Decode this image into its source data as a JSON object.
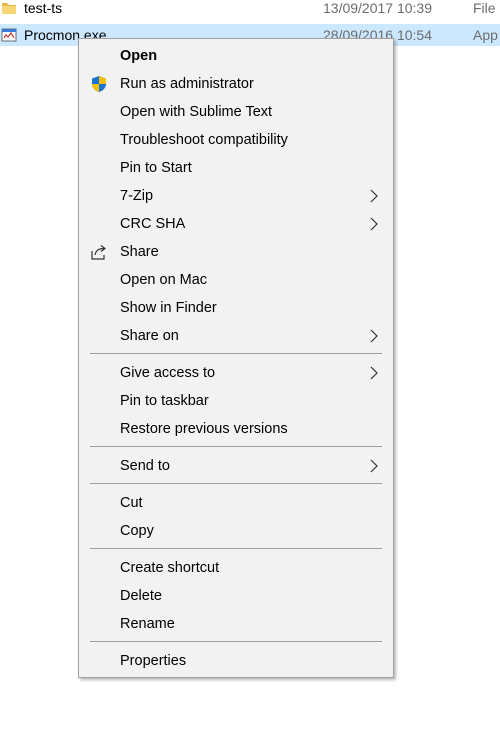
{
  "files": [
    {
      "name": "test-ts",
      "date": "13/09/2017 10:39",
      "type": "File",
      "icon": "folder-icon"
    },
    {
      "name": "Procmon.exe",
      "date": "28/09/2016 10:54",
      "type": "App",
      "icon": "application-icon"
    }
  ],
  "menu": {
    "open": "Open",
    "run_as_admin": "Run as administrator",
    "open_with_sublime": "Open with Sublime Text",
    "troubleshoot": "Troubleshoot compatibility",
    "pin_to_start": "Pin to Start",
    "seven_zip": "7-Zip",
    "crc_sha": "CRC SHA",
    "share": "Share",
    "open_on_mac": "Open on Mac",
    "show_in_finder": "Show in Finder",
    "share_on": "Share on",
    "give_access_to": "Give access to",
    "pin_to_taskbar": "Pin to taskbar",
    "restore_previous": "Restore previous versions",
    "send_to": "Send to",
    "cut": "Cut",
    "copy": "Copy",
    "create_shortcut": "Create shortcut",
    "delete": "Delete",
    "rename": "Rename",
    "properties": "Properties"
  },
  "colors": {
    "selection": "#cce8ff",
    "menu_background": "#f2f2f2",
    "separator": "#a0a0a0",
    "shield_blue": "#1b73d6",
    "shield_yellow": "#f5c000"
  }
}
